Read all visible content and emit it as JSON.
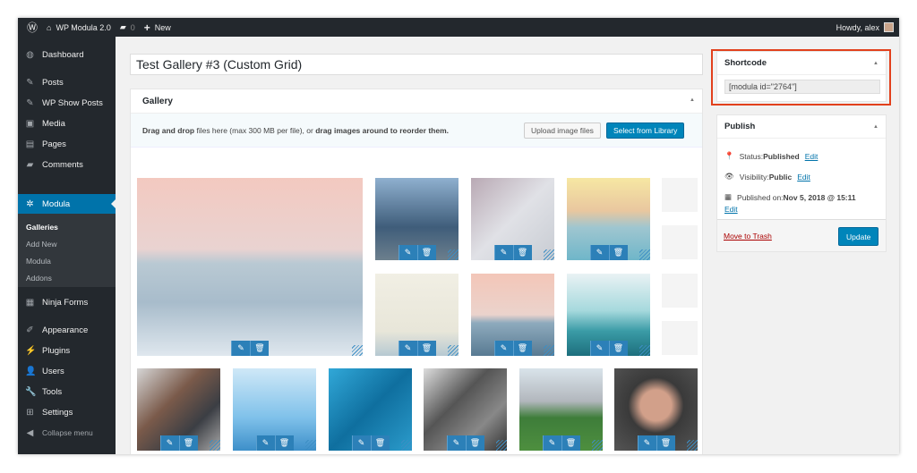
{
  "adminbar": {
    "site": "WP Modula 2.0",
    "comments": "0",
    "new": "New",
    "howdy": "Howdy, alex"
  },
  "sidebar": {
    "items": [
      {
        "label": "Dashboard",
        "icon": "dashboard-icon"
      },
      {
        "label": "Posts",
        "icon": "pin-icon"
      },
      {
        "label": "WP Show Posts",
        "icon": "pin-icon"
      },
      {
        "label": "Media",
        "icon": "media-icon"
      },
      {
        "label": "Pages",
        "icon": "pages-icon"
      },
      {
        "label": "Comments",
        "icon": "comment-icon"
      },
      {
        "label": "Modula",
        "icon": "gear-icon"
      },
      {
        "label": "Ninja Forms",
        "icon": "form-icon"
      },
      {
        "label": "Appearance",
        "icon": "brush-icon"
      },
      {
        "label": "Plugins",
        "icon": "plugin-icon"
      },
      {
        "label": "Users",
        "icon": "users-icon"
      },
      {
        "label": "Tools",
        "icon": "wrench-icon"
      },
      {
        "label": "Settings",
        "icon": "settings-icon"
      },
      {
        "label": "Collapse menu",
        "icon": "collapse-icon"
      }
    ],
    "submenu": [
      "Galleries",
      "Add New",
      "Modula",
      "Addons"
    ]
  },
  "title": "Test Gallery #3 (Custom Grid)",
  "gallery": {
    "heading": "Gallery",
    "drop_bold1": "Drag and drop",
    "drop_mid": " files here (max 300 MB per file), or ",
    "drop_bold2": "drag images around to reorder them.",
    "upload": "Upload image files",
    "select": "Select from Library"
  },
  "shortcode": {
    "heading": "Shortcode",
    "value": "[modula id=\"2764\"]"
  },
  "publish": {
    "heading": "Publish",
    "status_label": "Status: ",
    "status": "Published",
    "visibility_label": "Visibility: ",
    "visibility": "Public",
    "published_label": "Published on: ",
    "published": "Nov 5, 2018 @ 15:11",
    "edit": "Edit",
    "trash": "Move to Trash",
    "update": "Update"
  },
  "colors": {
    "accent": "#0073aa",
    "highlight": "#e2401c"
  }
}
